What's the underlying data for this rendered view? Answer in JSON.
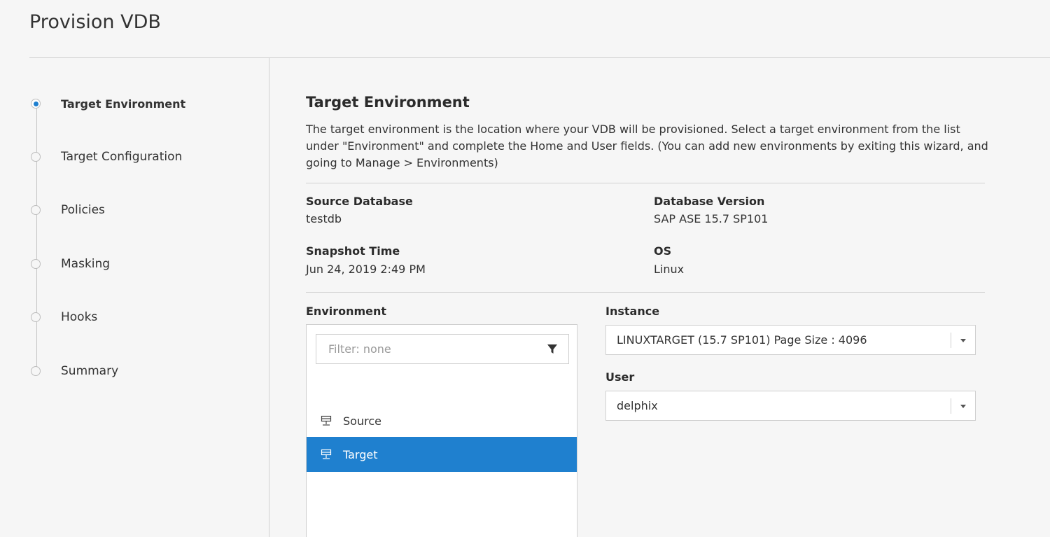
{
  "page": {
    "title": "Provision VDB"
  },
  "stepper": {
    "steps": [
      {
        "label": "Target Environment",
        "active": true
      },
      {
        "label": "Target Configuration",
        "active": false
      },
      {
        "label": "Policies",
        "active": false
      },
      {
        "label": "Masking",
        "active": false
      },
      {
        "label": "Hooks",
        "active": false
      },
      {
        "label": "Summary",
        "active": false
      }
    ]
  },
  "section": {
    "title": "Target Environment",
    "description": "The target environment is the location where your VDB will be provisioned. Select a target environment from the list under \"Environment\" and complete the Home and User fields. (You can add new environments by exiting this wizard, and going to Manage > Environments)"
  },
  "info": {
    "source_database": {
      "label": "Source Database",
      "value": "testdb"
    },
    "database_version": {
      "label": "Database Version",
      "value": "SAP ASE 15.7 SP101"
    },
    "snapshot_time": {
      "label": "Snapshot Time",
      "value": "Jun 24, 2019 2:49 PM"
    },
    "os": {
      "label": "OS",
      "value": "Linux"
    }
  },
  "environment": {
    "label": "Environment",
    "filter_placeholder": "Filter: none",
    "items": [
      {
        "label": "Source",
        "selected": false,
        "icon": "environment-icon"
      },
      {
        "label": "Target",
        "selected": true,
        "icon": "environment-icon"
      }
    ]
  },
  "instance": {
    "label": "Instance",
    "value": "LINUXTARGET (15.7 SP101) Page Size : 4096"
  },
  "user": {
    "label": "User",
    "value": "delphix"
  },
  "colors": {
    "accent": "#1f80cf",
    "background": "#f6f6f6"
  }
}
